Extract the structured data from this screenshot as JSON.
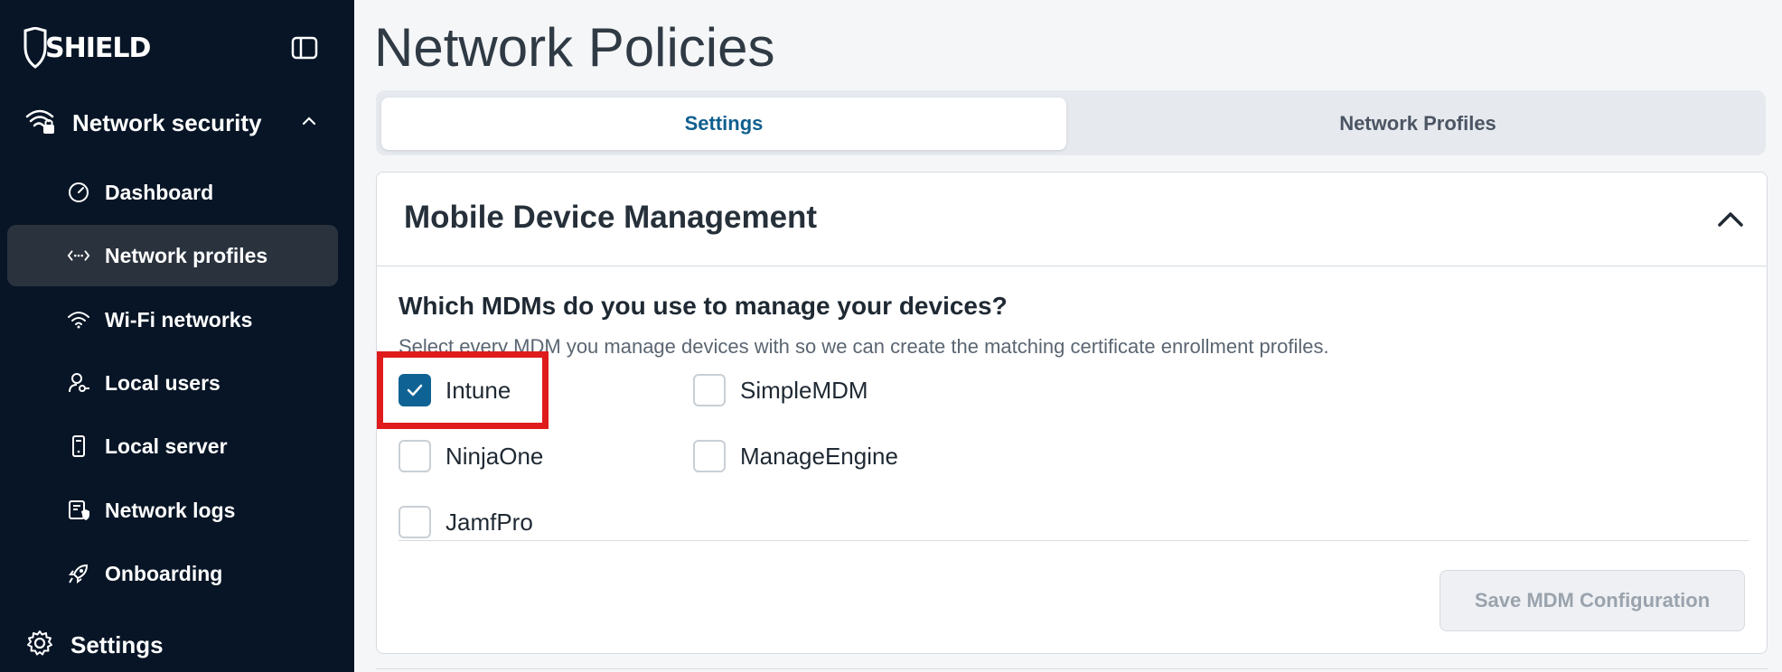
{
  "sidebar": {
    "logo_text": "SHIELD",
    "section": {
      "label": "Network security",
      "icon": "wifi-lock-icon",
      "expanded": true
    },
    "items": [
      {
        "label": "Dashboard",
        "icon": "gauge-icon",
        "active": false
      },
      {
        "label": "Network profiles",
        "icon": "arrows-dots-icon",
        "active": true
      },
      {
        "label": "Wi-Fi networks",
        "icon": "wifi-icon",
        "active": false
      },
      {
        "label": "Local users",
        "icon": "user-key-icon",
        "active": false
      },
      {
        "label": "Local server",
        "icon": "server-phone-icon",
        "active": false
      },
      {
        "label": "Network logs",
        "icon": "logs-shield-icon",
        "active": false
      },
      {
        "label": "Onboarding",
        "icon": "rocket-icon",
        "active": false
      }
    ],
    "settings_label": "Settings"
  },
  "main": {
    "title": "Network Policies",
    "tabs": [
      {
        "label": "Settings",
        "active": true
      },
      {
        "label": "Network Profiles",
        "active": false
      }
    ],
    "card": {
      "title": "Mobile Device Management",
      "question": "Which MDMs do you use to manage your devices?",
      "hint": "Select every MDM you manage devices with so we can create the matching certificate enrollment profiles.",
      "options": [
        {
          "label": "Intune",
          "checked": true
        },
        {
          "label": "SimpleMDM",
          "checked": false
        },
        {
          "label": "NinjaOne",
          "checked": false
        },
        {
          "label": "ManageEngine",
          "checked": false
        },
        {
          "label": "JamfPro",
          "checked": false
        }
      ],
      "save_label": "Save MDM Configuration"
    }
  },
  "colors": {
    "sidebar_bg": "#071526",
    "active_item_bg": "#2a323d",
    "accent": "#0f6394",
    "highlight": "#e01b1b"
  }
}
